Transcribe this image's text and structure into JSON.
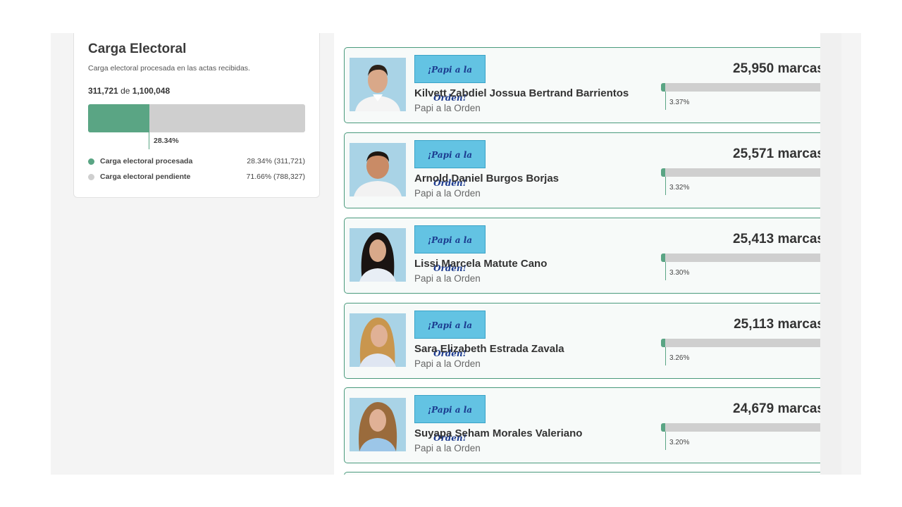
{
  "carga": {
    "title": "Carga Electoral",
    "subtitle": "Carga electoral procesada en las actas recibidas.",
    "processed": "311,721",
    "connector": "de",
    "total": "1,100,048",
    "processed_fraction": 0.2834,
    "percent_label": "28.34%",
    "legend": [
      {
        "label": "Carga electoral procesada",
        "value": "28.34% (311,721)",
        "color": "#5aa584"
      },
      {
        "label": "Carga electoral pendiente",
        "value": "71.66% (788,327)",
        "color": "#cfcfcf"
      }
    ]
  },
  "candidates": [
    {
      "name": "Kilvett Zabdiel Jossua Bertrand Barrientos",
      "party": "Papi a la Orden",
      "logo_text": "¡Papi a la Orden!",
      "votes": "25,950 marcas",
      "percent": "3.37%",
      "fraction": 0.0337
    },
    {
      "name": "Arnold Daniel Burgos Borjas",
      "party": "Papi a la Orden",
      "logo_text": "¡Papi a la Orden!",
      "votes": "25,571 marcas",
      "percent": "3.32%",
      "fraction": 0.0332
    },
    {
      "name": "Lissi Marcela Matute Cano",
      "party": "Papi a la Orden",
      "logo_text": "¡Papi a la Orden!",
      "votes": "25,413 marcas",
      "percent": "3.30%",
      "fraction": 0.033
    },
    {
      "name": "Sara Elizabeth Estrada Zavala",
      "party": "Papi a la Orden",
      "logo_text": "¡Papi a la Orden!",
      "votes": "25,113 marcas",
      "percent": "3.26%",
      "fraction": 0.0326
    },
    {
      "name": "Suyapa Seham Morales Valeriano",
      "party": "Papi a la Orden",
      "logo_text": "¡Papi a la Orden!",
      "votes": "24,679 marcas",
      "percent": "3.20%",
      "fraction": 0.032
    }
  ],
  "colors": {
    "accent": "#5aa584",
    "border": "#4a9a7c",
    "bar_bg": "#cfcfcf",
    "logo_bg": "#63c3e3"
  }
}
